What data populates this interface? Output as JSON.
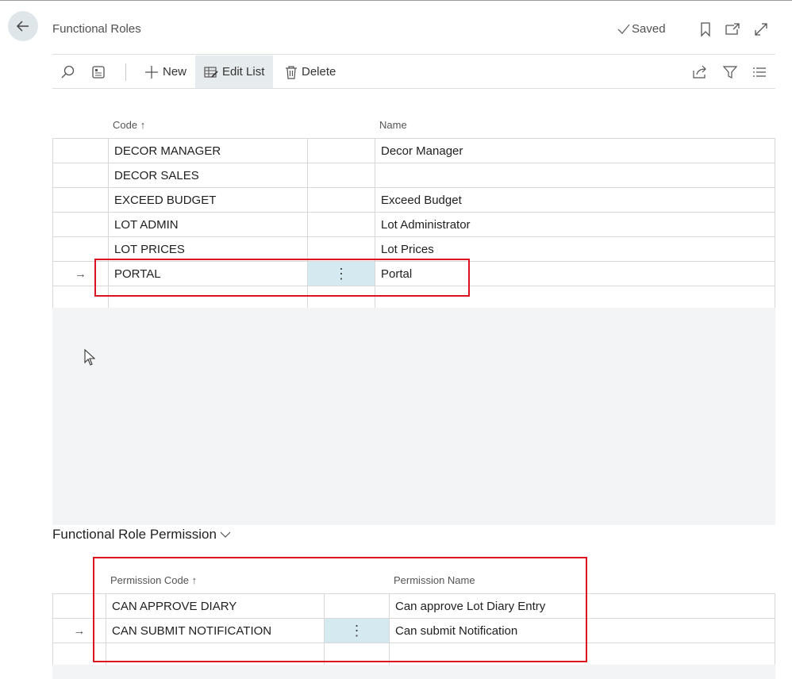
{
  "header": {
    "title": "Functional Roles",
    "saved_label": "Saved"
  },
  "toolbar": {
    "new_label": "New",
    "edit_list_label": "Edit List",
    "delete_label": "Delete"
  },
  "roles_table": {
    "columns": [
      "Code",
      "Name"
    ],
    "sort_indicator": "↑",
    "rows": [
      {
        "code": "DECOR MANAGER",
        "name": "Decor Manager"
      },
      {
        "code": "DECOR SALES",
        "name": ""
      },
      {
        "code": "EXCEED BUDGET",
        "name": "Exceed Budget"
      },
      {
        "code": "LOT ADMIN",
        "name": "Lot Administrator"
      },
      {
        "code": "LOT PRICES",
        "name": "Lot Prices"
      },
      {
        "code": "PORTAL",
        "name": "Portal"
      }
    ],
    "selected_row_index": 5
  },
  "permission_section": {
    "title": "Functional Role Permission",
    "columns": [
      "Permission Code",
      "Permission Name"
    ],
    "rows": [
      {
        "code": "CAN APPROVE DIARY",
        "name": "Can approve Lot Diary Entry"
      },
      {
        "code": "CAN SUBMIT NOTIFICATION",
        "name": "Can submit Notification"
      }
    ],
    "selected_row_index": 1
  },
  "icons": {
    "back": "arrow-left-icon",
    "bookmark": "bookmark-icon",
    "open_new": "open-in-new-window-icon",
    "expand": "expand-icon",
    "search": "search-icon",
    "layout": "page-layout-icon",
    "share": "share-icon",
    "filter": "filter-icon",
    "list": "list-view-icon",
    "row_menu": "more-vertical-icon",
    "row_arrow": "arrow-right-icon",
    "cursor": "mouse-cursor-icon"
  },
  "colors": {
    "highlight": "#d9141c",
    "menu_cell": "#d5eaf0",
    "gray_area": "#f2f4f5"
  }
}
